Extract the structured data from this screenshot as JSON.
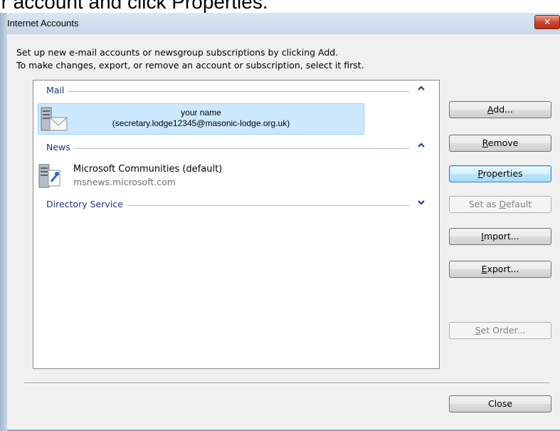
{
  "caption": "ur account and click Properties.",
  "window": {
    "title": "Internet Accounts",
    "close_glyph": "✕"
  },
  "intro": {
    "line1": "Set up new e-mail accounts or newsgroup subscriptions by clicking Add.",
    "line2": "To make changes, export, or remove an account or subscription, select it first."
  },
  "groups": {
    "mail": {
      "label": "Mail",
      "chevron": "⌃"
    },
    "news": {
      "label": "News",
      "chevron": "⌃"
    },
    "directory": {
      "label": "Directory Service",
      "chevron": "⌄"
    }
  },
  "mail_account": {
    "name": "your name",
    "email": "(secretary.lodge12345@masonic-lodge.org.uk)",
    "icon": "mail-server-icon"
  },
  "news_account": {
    "title": "Microsoft Communities (default)",
    "host": "msnews.microsoft.com",
    "icon": "news-server-icon"
  },
  "buttons": {
    "add": {
      "key": "A",
      "rest": "dd..."
    },
    "remove": {
      "key": "R",
      "rest": "emove"
    },
    "properties": {
      "key": "P",
      "rest": "roperties"
    },
    "set_default": {
      "pre": "Set as ",
      "key": "D",
      "rest": "efault"
    },
    "import": {
      "key": "I",
      "rest": "mport..."
    },
    "export": {
      "key": "E",
      "rest": "xport..."
    },
    "set_order": {
      "key": "S",
      "rest": "et Order..."
    },
    "close": {
      "label": "Close"
    }
  },
  "colors": {
    "selection": "#cce8ff",
    "group_header": "#1e3287",
    "close_button": "#c8452b"
  }
}
